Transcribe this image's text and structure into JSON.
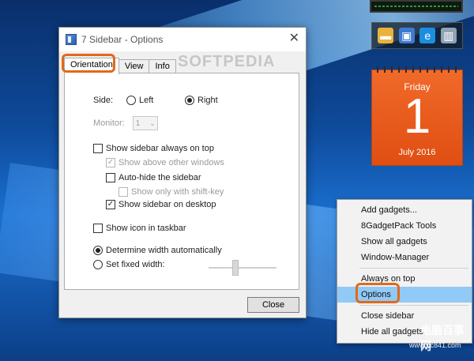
{
  "window": {
    "title": "7 Sidebar - Options",
    "close_glyph": "✕",
    "watermark": "SOFTPEDIA"
  },
  "tabs": [
    {
      "label": "Orientation",
      "active": true
    },
    {
      "label": "View",
      "active": false
    },
    {
      "label": "Info",
      "active": false
    }
  ],
  "orientation": {
    "side_label": "Side:",
    "side_left": "Left",
    "side_right": "Right",
    "side_selected": "Right",
    "monitor_label": "Monitor:",
    "monitor_value": "1",
    "show_always_on_top": "Show sidebar always on top",
    "show_above_other": "Show above other windows",
    "auto_hide": "Auto-hide the sidebar",
    "show_only_shift": "Show only with shift-key",
    "show_on_desktop": "Show sidebar on desktop",
    "show_icon_taskbar": "Show icon in taskbar",
    "width_auto": "Determine width automatically",
    "width_fixed": "Set fixed width:"
  },
  "buttons": {
    "close": "Close"
  },
  "calendar": {
    "day": "Friday",
    "date": "1",
    "month_year": "July 2016"
  },
  "context_menu": {
    "items": [
      "Add gadgets...",
      "8GadgetPack Tools",
      "Show all gadgets",
      "Window-Manager",
      "Always on top",
      "Options",
      "Close sidebar",
      "Hide all gadgets"
    ],
    "highlighted": "Options"
  },
  "branding": {
    "text": "电脑百事网",
    "url": "www.pc841.com"
  },
  "colors": {
    "highlight_outline": "#e06a1a",
    "calendar_bg": "#e85a1c",
    "menu_hover": "#91c9f7"
  }
}
